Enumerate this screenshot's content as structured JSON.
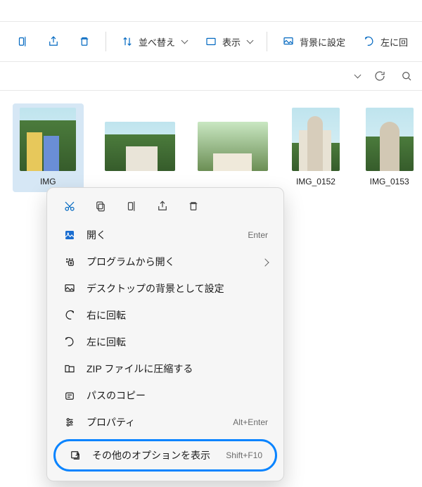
{
  "toolbar": {
    "sort_label": "並べ替え",
    "view_label": "表示",
    "set_bg_label": "背景に設定",
    "rotate_left_label": "左に回"
  },
  "thumbs": [
    {
      "label": "IMG"
    },
    {
      "label": ""
    },
    {
      "label": ""
    },
    {
      "label": "IMG_0152"
    },
    {
      "label": "IMG_0153"
    }
  ],
  "context_menu": {
    "open": {
      "label": "開く",
      "hint": "Enter"
    },
    "open_with": {
      "label": "プログラムから開く"
    },
    "set_bg": {
      "label": "デスクトップの背景として設定"
    },
    "rot_r": {
      "label": "右に回転"
    },
    "rot_l": {
      "label": "左に回転"
    },
    "zip": {
      "label": "ZIP ファイルに圧縮する"
    },
    "copy_path": {
      "label": "パスのコピー"
    },
    "props": {
      "label": "プロパティ",
      "hint": "Alt+Enter"
    },
    "more": {
      "label": "その他のオプションを表示",
      "hint": "Shift+F10"
    }
  }
}
